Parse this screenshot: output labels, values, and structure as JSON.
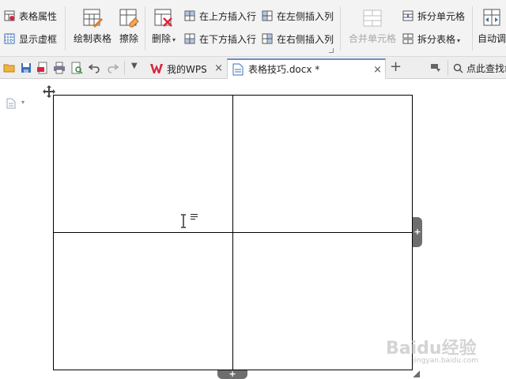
{
  "ribbon": {
    "table_properties": "表格属性",
    "show_gridlines": "显示虚框",
    "draw_table": "绘制表格",
    "erase": "擦除",
    "delete": "删除",
    "insert_row_above": "在上方插入行",
    "insert_row_below": "在下方插入行",
    "insert_col_left": "在左侧插入列",
    "insert_col_right": "在右侧插入列",
    "merge_cells": "合并单元格",
    "split_cells": "拆分单元格",
    "split_table": "拆分表格",
    "auto_adjust": "自动调"
  },
  "tabs": [
    {
      "label": "我的WPS",
      "close": "×"
    },
    {
      "label": "表格技巧.docx *",
      "close": "×"
    }
  ],
  "tabbar": {
    "new_tab": "+",
    "search_label": "点此查找命"
  },
  "table": {
    "rows": [
      [
        "",
        ""
      ],
      [
        "",
        ""
      ]
    ]
  },
  "handles": {
    "add_column": "+",
    "add_row": "+"
  },
  "watermark": {
    "brand": "Baidu经验",
    "site": "jingyan.baidu.com"
  },
  "colors": {
    "ribbon_bg": "#f3f3f3",
    "wps_red": "#d7263d",
    "doc_blue": "#3e6fb5",
    "handle_gray": "#6e6e6e"
  }
}
